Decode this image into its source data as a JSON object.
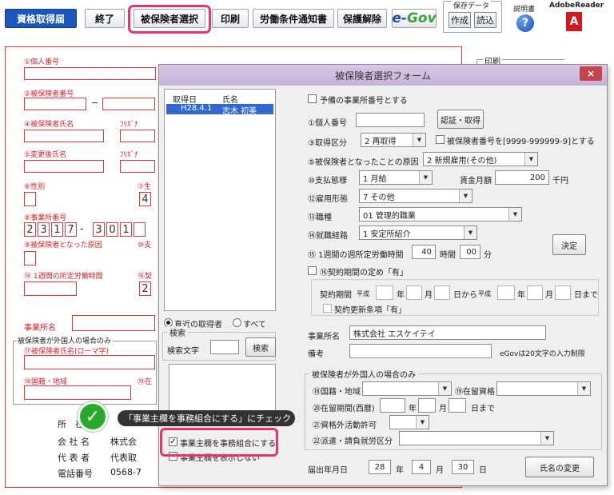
{
  "toolbar": {
    "acquire_report": "資格取得届",
    "exit": "終了",
    "select_insured": "被保険者選択",
    "print": "印刷",
    "labor_notice": "労働条件通知書",
    "unlock": "保護解除",
    "egov_prefix": "e-",
    "egov_suffix": "Gov",
    "template_title": "保存データ",
    "create": "作成",
    "load": "読込",
    "manual": "説明書",
    "adobe": "AdobeReader"
  },
  "bg_form": {
    "labels": {
      "personal_number": "①個人番号",
      "insured_number": "②被保険者番号",
      "insured_name": "④被保険者氏名",
      "furigana": "ﾌﾘｶﾞﾅ",
      "changed_name": "⑤変更後氏名",
      "furigana2": "ﾌﾘｶﾞﾅ",
      "gender": "⑥性別",
      "birth": "⑦生",
      "office_number": "⑧事業所番号",
      "reason": "⑨被保険者となった原因",
      "pay": "⑩支",
      "weekly_hours": "⑭ 1週間の所定労働時間",
      "contract": "⑯契",
      "office_name": "事業所名",
      "foreign_title": "被保険者が外国人の場合のみ",
      "romaji": "⑰被保険者氏名(ローマ字)",
      "nationality": "⑱国籍・地域",
      "residence": "⑲在"
    },
    "office_digits": [
      "2",
      "3",
      "1",
      "7",
      "-",
      "3",
      "0",
      "1"
    ],
    "birth_digit": "4",
    "contract_digit": "2",
    "print_group": "印刷",
    "footer": {
      "address_label": "所　在",
      "company_label": "会 社 名",
      "company_value": "株式会",
      "rep_label": "代 表 者",
      "rep_value": "代表取",
      "phone_label": "電話番号",
      "phone_value": "0568-7"
    }
  },
  "dialog": {
    "title": "被保険者選択フォーム",
    "close": "×",
    "list": {
      "col_date": "取得日",
      "col_name": "氏名",
      "rows": [
        {
          "date": "H28.4.1",
          "name": "志木 初美"
        }
      ]
    },
    "filter": {
      "recent": "直近の取得者",
      "all": "すべて",
      "search_group": "検索",
      "search_label": "検索文字",
      "search_value": "",
      "search_button": "検索"
    },
    "office_check_label": "事業主欄を事務組合にする",
    "office_hide_label": "事業主欄を表示しない",
    "form": {
      "prev_office": "予備の事業所番号とする",
      "personal_number": "①個人番号",
      "personal_number_value": "",
      "verify_button": "認証・取得",
      "acquire_type": "③取得区分",
      "acquire_type_value": "2 再取得",
      "insured_num_note": "被保険者番号を[9999-999999-9]とする",
      "reason_label": "⑤被保険者となったことの原因",
      "reason_value": "2  新規雇用(その他)",
      "pay_label": "⑩支払態様",
      "pay_value": "1  月給",
      "wage_label": "賃金月額",
      "wage_value": "200",
      "wage_unit": "千円",
      "employ_label": "⑫雇用形態",
      "employ_value": "7  その他",
      "job_label": "⑬職種",
      "job_value": "01  管理的職業",
      "route_label": "⑭就職経路",
      "route_value": "1  安定所紹介",
      "weekly_label": "⑮ 1週間の週所定労働時間",
      "hours_value": "40",
      "hours_unit": "時間",
      "minutes_value": "00",
      "minutes_unit": "分",
      "confirm_button": "決定",
      "contract_label": "⑯契約期間の定め「有」",
      "contract_period": "契約期間",
      "era1": "平成",
      "year": "年",
      "month": "月",
      "from": "日から",
      "era2": "平成",
      "year2": "年",
      "month2": "月",
      "until": "日まで",
      "renew_label": "契約更新条項「有」",
      "office_label": "事業所名",
      "office_value": "株式会社  エスケイテイ",
      "remarks_label": "備考",
      "remarks_value": "",
      "egov_note": "eGovは20文字の入力制限",
      "foreign_group": "被保険者が外国人の場合のみ",
      "nationality_label": "⑱国籍・地域",
      "status_label": "⑲在留資格",
      "period_label": "⑳在留期間(西暦)",
      "period_year": "年",
      "period_month": "月",
      "period_until": "日まで",
      "permit_label": "㉑資格外活動許可",
      "dispatch_label": "㉒派遣・請負就労区分",
      "submit_label": "届出年月日",
      "submit_year_value": "28",
      "submit_year": "年",
      "submit_month_value": "4",
      "submit_month": "月",
      "submit_day_value": "30",
      "submit_day": "日",
      "rename_button": "氏名の変更"
    }
  },
  "callout_text": "「事業主欄を事務組合にする」にチェック",
  "colors": {
    "highlight": "#e8336d",
    "form_red": "#d0222a",
    "check_green": "#2aa82a",
    "dialog_title": "#c7b2d8"
  }
}
